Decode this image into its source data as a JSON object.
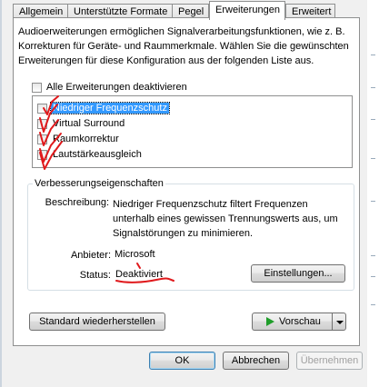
{
  "tabs": [
    {
      "label": "Allgemein",
      "active": false
    },
    {
      "label": "Unterstützte Formate",
      "active": false
    },
    {
      "label": "Pegel",
      "active": false
    },
    {
      "label": "Erweiterungen",
      "active": true
    },
    {
      "label": "Erweitert",
      "active": false
    }
  ],
  "description": "Audioerweiterungen ermöglichen Signalverarbeitungsfunktionen, wie z. B. Korrekturen für Geräte- und Raummerkmale. Wählen Sie die gewünschten Erweiterungen für diese Konfiguration aus der folgenden Liste aus.",
  "disable_all": {
    "label": "Alle Erweiterungen deaktivieren",
    "checked": false
  },
  "enhancements": [
    {
      "label": "Niedriger Frequenzschutz",
      "checked": false,
      "selected": true
    },
    {
      "label": "Virtual Surround",
      "checked": false,
      "selected": false
    },
    {
      "label": "Raumkorrektur",
      "checked": false,
      "selected": false
    },
    {
      "label": "Lautstärkeausgleich",
      "checked": false,
      "selected": false
    }
  ],
  "properties": {
    "group_title": "Verbesserungseigenschaften",
    "description_label": "Beschreibung:",
    "description_value": "Niedriger Frequenzschutz filtert Frequenzen unterhalb eines gewissen Trennungswerts aus, um Signalstörungen zu minimieren.",
    "provider_label": "Anbieter:",
    "provider_value": "Microsoft",
    "status_label": "Status:",
    "status_value": "Deaktiviert",
    "settings_button": "Einstellungen..."
  },
  "buttons": {
    "restore_defaults": "Standard wiederherstellen",
    "preview": "Vorschau",
    "ok": "OK",
    "cancel": "Abbrechen",
    "apply": "Übernehmen"
  },
  "annotation_color": "#e0191c",
  "selection_color": "#3399ff",
  "preview_icon_color": "#1f9d2a"
}
